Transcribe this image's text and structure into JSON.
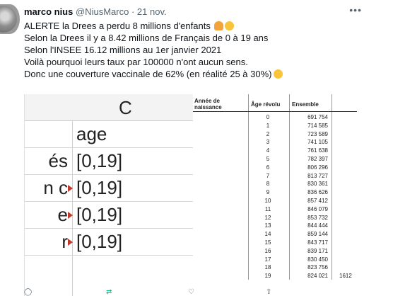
{
  "tweet": {
    "author_name": "marco nius",
    "author_handle": "@NiusMarco",
    "separator": "·",
    "date": "21 nov.",
    "more_icon": "more-horizontal-icon",
    "lines": [
      "ALERTE la Drees a perdu 8 millions d'enfants",
      "Selon la Drees il y a 8.42 millions de Français de 0 à 19 ans",
      "Selon l'INSEE 16.12 millions au 1er janvier 2021",
      "Voilà pourquoi leurs taux par 100000 n'ont aucun sens.",
      "Donc une couverture vaccinale de 62% (en réalité 25 à 30%)"
    ]
  },
  "spreadsheet": {
    "column_header": "C",
    "rows": [
      {
        "left": "",
        "value": "age",
        "flag": false
      },
      {
        "left": "és",
        "value": "[0,19]",
        "flag": false
      },
      {
        "left": "n c",
        "value": "[0,19]",
        "flag": true
      },
      {
        "left": "e",
        "value": "[0,19]",
        "flag": true
      },
      {
        "left": "r",
        "value": "[0,19]",
        "flag": true
      }
    ]
  },
  "population_table": {
    "headers": {
      "year": "Année de naissance",
      "age": "Âge révolu",
      "total": "Ensemble"
    },
    "rows": [
      {
        "age": "0",
        "total": "691 754"
      },
      {
        "age": "1",
        "total": "714 585"
      },
      {
        "age": "2",
        "total": "723 589"
      },
      {
        "age": "3",
        "total": "741 105"
      },
      {
        "age": "4",
        "total": "761 638"
      },
      {
        "age": "5",
        "total": "782 397"
      },
      {
        "age": "6",
        "total": "806 296"
      },
      {
        "age": "7",
        "total": "813 727"
      },
      {
        "age": "8",
        "total": "830 361"
      },
      {
        "age": "9",
        "total": "836 626"
      },
      {
        "age": "10",
        "total": "857 412"
      },
      {
        "age": "11",
        "total": "846 079"
      },
      {
        "age": "12",
        "total": "853 732"
      },
      {
        "age": "13",
        "total": "844 444"
      },
      {
        "age": "14",
        "total": "859 144"
      },
      {
        "age": "15",
        "total": "843 717"
      },
      {
        "age": "16",
        "total": "839 171"
      },
      {
        "age": "17",
        "total": "830 450"
      },
      {
        "age": "18",
        "total": "823 756"
      },
      {
        "age": "19",
        "total": "824 021"
      }
    ],
    "cut_off_sum": "1612"
  },
  "actions": {
    "reply_icon": "reply-icon",
    "retweet_icon": "retweet-icon",
    "like_icon": "heart-icon",
    "share_icon": "share-icon"
  }
}
